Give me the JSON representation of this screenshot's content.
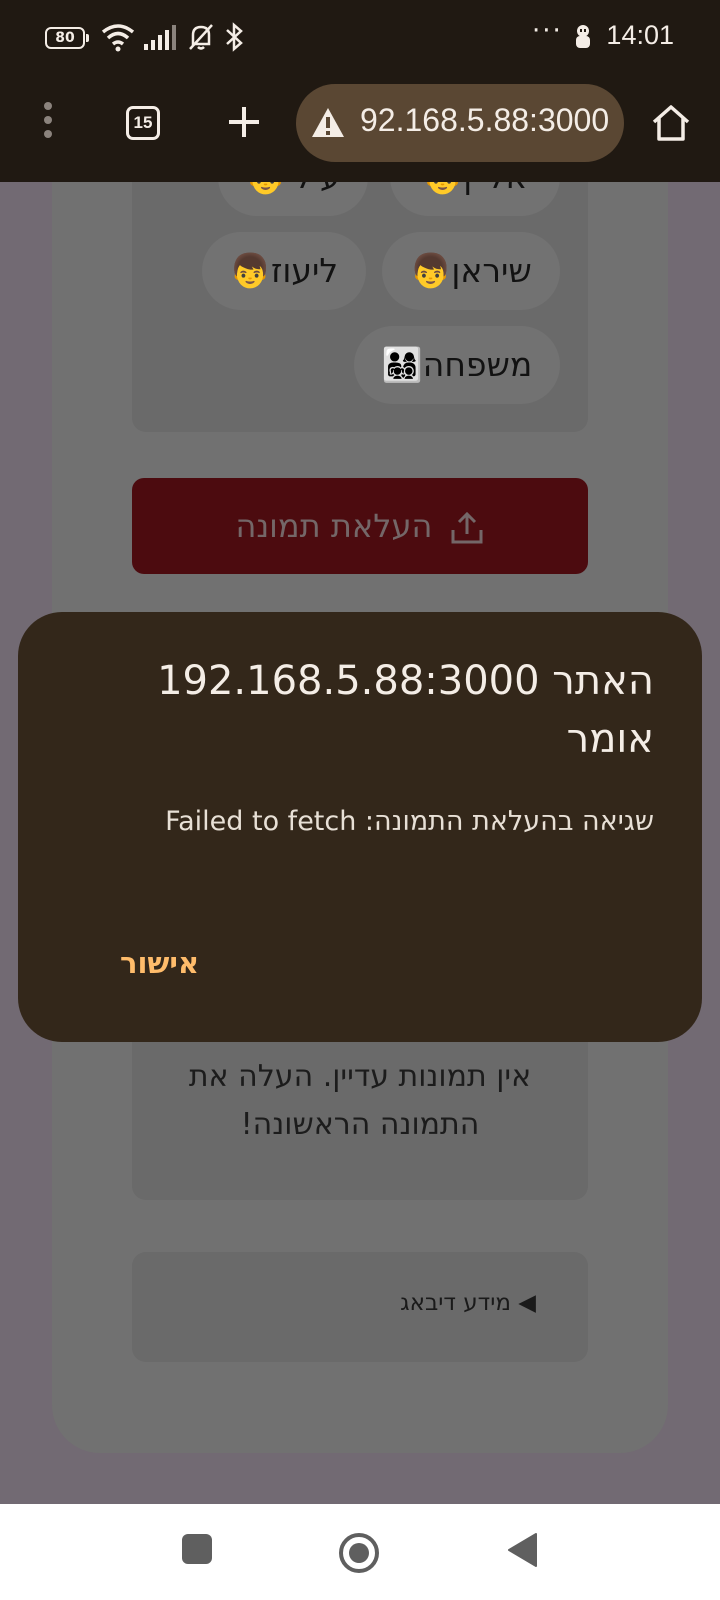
{
  "status_bar": {
    "battery": "80",
    "dots": "···",
    "time": "14:01",
    "icons": [
      "wifi-icon",
      "signal-icon",
      "bell-off-icon",
      "bluetooth-icon",
      "notification-icon"
    ]
  },
  "toolbar": {
    "tab_count": "15",
    "url": "92.168.5.88:3000",
    "icons": [
      "menu-icon",
      "new-tab-icon",
      "warning-icon",
      "home-icon"
    ]
  },
  "page": {
    "chips": [
      {
        "label": "👦אליין"
      },
      {
        "label": "👦עילי"
      },
      {
        "label": "👦שיראן"
      },
      {
        "label": "👦ליעוז"
      },
      {
        "label": "👨‍👩‍👧‍👦משפחה"
      }
    ],
    "upload_button": "העלאת תמונה",
    "empty_text": "אין תמונות עדיין. העלה את התמונה הראשונה!",
    "debug_summary": "◀ מידע דיבאג"
  },
  "dialog": {
    "title": "האתר 192.168.5.88:3000 אומר",
    "message": "שגיאה בהעלאת התמונה: Failed to fetch",
    "ok_button": "אישור"
  },
  "nav_bar": {
    "icons": [
      "recents-icon",
      "home-icon",
      "back-icon"
    ]
  },
  "colors": {
    "status_bar_bg": "#201912",
    "dialog_bg": "#33271a",
    "dialog_accent": "#ffbc6b",
    "upload_button_bg": "#4c0b0f"
  }
}
